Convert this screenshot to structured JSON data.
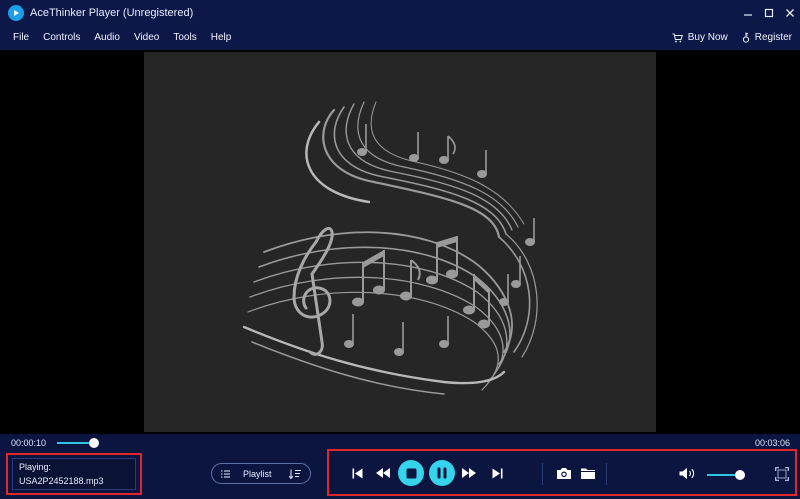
{
  "window": {
    "title": "AceThinker Player (Unregistered)",
    "controls": [
      "minimize",
      "maximize",
      "close"
    ]
  },
  "menu": {
    "items": [
      "File",
      "Controls",
      "Audio",
      "Video",
      "Tools",
      "Help"
    ],
    "buy_now": "Buy Now",
    "register": "Register"
  },
  "player": {
    "current_time": "00:00:10",
    "total_time": "00:03:06",
    "progress_fraction": 0.05,
    "volume_fraction": 0.8
  },
  "now_playing": {
    "label": "Playing:",
    "file": "USA2P2452188.mp3"
  },
  "playlist": {
    "label": "Playlist"
  },
  "colors": {
    "background": "#0c1540",
    "accent": "#35d4ec",
    "highlight_box": "#e0282c"
  }
}
